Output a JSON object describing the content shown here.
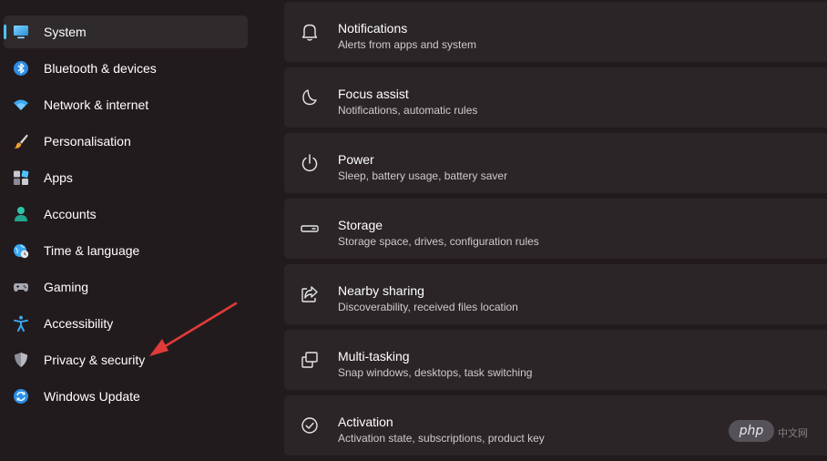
{
  "sidebar": {
    "items": [
      {
        "label": "System",
        "icon": "monitor-icon",
        "selected": true
      },
      {
        "label": "Bluetooth & devices",
        "icon": "bluetooth-icon"
      },
      {
        "label": "Network & internet",
        "icon": "wifi-icon"
      },
      {
        "label": "Personalisation",
        "icon": "brush-icon"
      },
      {
        "label": "Apps",
        "icon": "apps-icon"
      },
      {
        "label": "Accounts",
        "icon": "person-icon"
      },
      {
        "label": "Time & language",
        "icon": "globe-clock-icon"
      },
      {
        "label": "Gaming",
        "icon": "gamepad-icon"
      },
      {
        "label": "Accessibility",
        "icon": "accessibility-icon"
      },
      {
        "label": "Privacy & security",
        "icon": "shield-icon"
      },
      {
        "label": "Windows Update",
        "icon": "update-icon"
      }
    ]
  },
  "main": {
    "cards": [
      {
        "title": "Notifications",
        "subtitle": "Alerts from apps and system",
        "icon": "bell-icon"
      },
      {
        "title": "Focus assist",
        "subtitle": "Notifications, automatic rules",
        "icon": "moon-icon"
      },
      {
        "title": "Power",
        "subtitle": "Sleep, battery usage, battery saver",
        "icon": "power-icon"
      },
      {
        "title": "Storage",
        "subtitle": "Storage space, drives, configuration rules",
        "icon": "storage-icon"
      },
      {
        "title": "Nearby sharing",
        "subtitle": "Discoverability, received files location",
        "icon": "share-icon"
      },
      {
        "title": "Multi-tasking",
        "subtitle": "Snap windows, desktops, task switching",
        "icon": "multitask-icon"
      },
      {
        "title": "Activation",
        "subtitle": "Activation state, subscriptions, product key",
        "icon": "check-circle-icon"
      }
    ]
  },
  "colors": {
    "accent": "#4cc2ff",
    "annotation_arrow": "#e03a3a"
  },
  "watermark": {
    "text": "php",
    "secondary": "中文网"
  }
}
